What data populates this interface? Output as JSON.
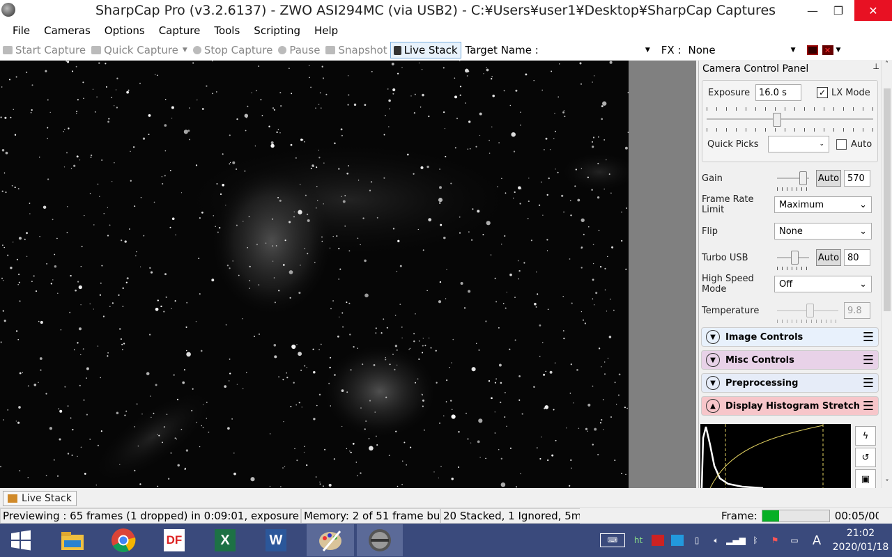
{
  "window": {
    "title": "SharpCap Pro (v3.2.6137) - ZWO ASI294MC (via USB2) - C:¥Users¥user1¥Desktop¥SharpCap Captures",
    "min": "—",
    "max": "❐",
    "close": "✕"
  },
  "menu": [
    "File",
    "Cameras",
    "Options",
    "Capture",
    "Tools",
    "Scripting",
    "Help"
  ],
  "toolbar": {
    "start_capture": "Start Capture",
    "quick_capture": "Quick Capture",
    "stop_capture": "Stop Capture",
    "pause": "Pause",
    "snapshot": "Snapshot",
    "live_stack": "Live Stack",
    "target_name_label": "Target Name :",
    "target_name_value": "",
    "fx_label": "FX :",
    "fx_value": "None"
  },
  "panel": {
    "title": "Camera Control Panel",
    "exposure_label": "Exposure",
    "exposure_value": "16.0 s",
    "lx_mode_label": "LX Mode",
    "lx_mode_checked": true,
    "exposure_slider_fraction": 0.42,
    "quick_picks_label": "Quick Picks",
    "quick_picks_value": "",
    "auto_label": "Auto",
    "gain_label": "Gain",
    "gain_auto": "Auto",
    "gain_value": "570",
    "gain_slider_fraction": 0.95,
    "frame_rate_label": "Frame Rate Limit",
    "frame_rate_value": "Maximum",
    "flip_label": "Flip",
    "flip_value": "None",
    "turbo_label": "Turbo USB",
    "turbo_auto": "Auto",
    "turbo_value": "80",
    "turbo_slider_fraction": 0.6,
    "hsm_label": "High Speed Mode",
    "hsm_value": "Off",
    "temp_label": "Temperature",
    "temp_value": "9.8",
    "temp_slider_fraction": 0.55,
    "sections": [
      {
        "label": "Image Controls",
        "color": "#e8f1fc"
      },
      {
        "label": "Misc Controls",
        "color": "#e8d2e8"
      },
      {
        "label": "Preprocessing",
        "color": "#e6ecf8"
      },
      {
        "label": "Display Histogram Stretch",
        "color": "#f7c6ca"
      }
    ]
  },
  "bottom_tab": "Live Stack",
  "status": {
    "preview": "Previewing : 65 frames (1 dropped) in 0:09:01, exposure :",
    "memory": "Memory: 2 of 51 frame buf",
    "stacked": "20 Stacked, 1 Ignored, 5m",
    "frame_label": "Frame:",
    "frame_progress": 0.25,
    "time": "00:05/00"
  },
  "taskbar": {
    "apps": [
      "start-icon",
      "file-explorer-icon",
      "chrome-icon",
      "df-icon",
      "excel-icon",
      "word-icon",
      "paint-icon",
      "sharpcap-icon"
    ],
    "time": "21:02",
    "date": "2020/01/18",
    "ime": "A"
  }
}
